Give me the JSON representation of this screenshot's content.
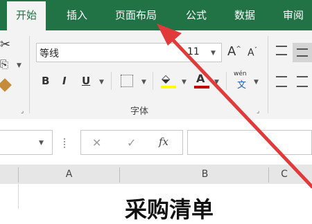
{
  "tabs": [
    "开始",
    "插入",
    "页面布局",
    "公式",
    "数据",
    "审阅"
  ],
  "ribbon": {
    "font_name": "等线",
    "font_size": "11",
    "bold": "B",
    "italic": "I",
    "underline": "U",
    "increase_font": "A",
    "decrease_font": "A",
    "font_color_label": "A",
    "phonetic_top": "wén",
    "phonetic_bottom": "文",
    "font_group_label": "字体"
  },
  "formula_bar": {
    "cancel": "✕",
    "enter": "✓",
    "fx": "fx"
  },
  "columns": [
    "A",
    "B",
    "C"
  ],
  "cell_text": "采购清单",
  "colors": {
    "tab_bar": "#217346",
    "ribbon_bg": "#f3f3f3",
    "arrow": "#e03a3a",
    "font_color_bar": "#c00000",
    "fill_color_bar": "#ffff00"
  }
}
